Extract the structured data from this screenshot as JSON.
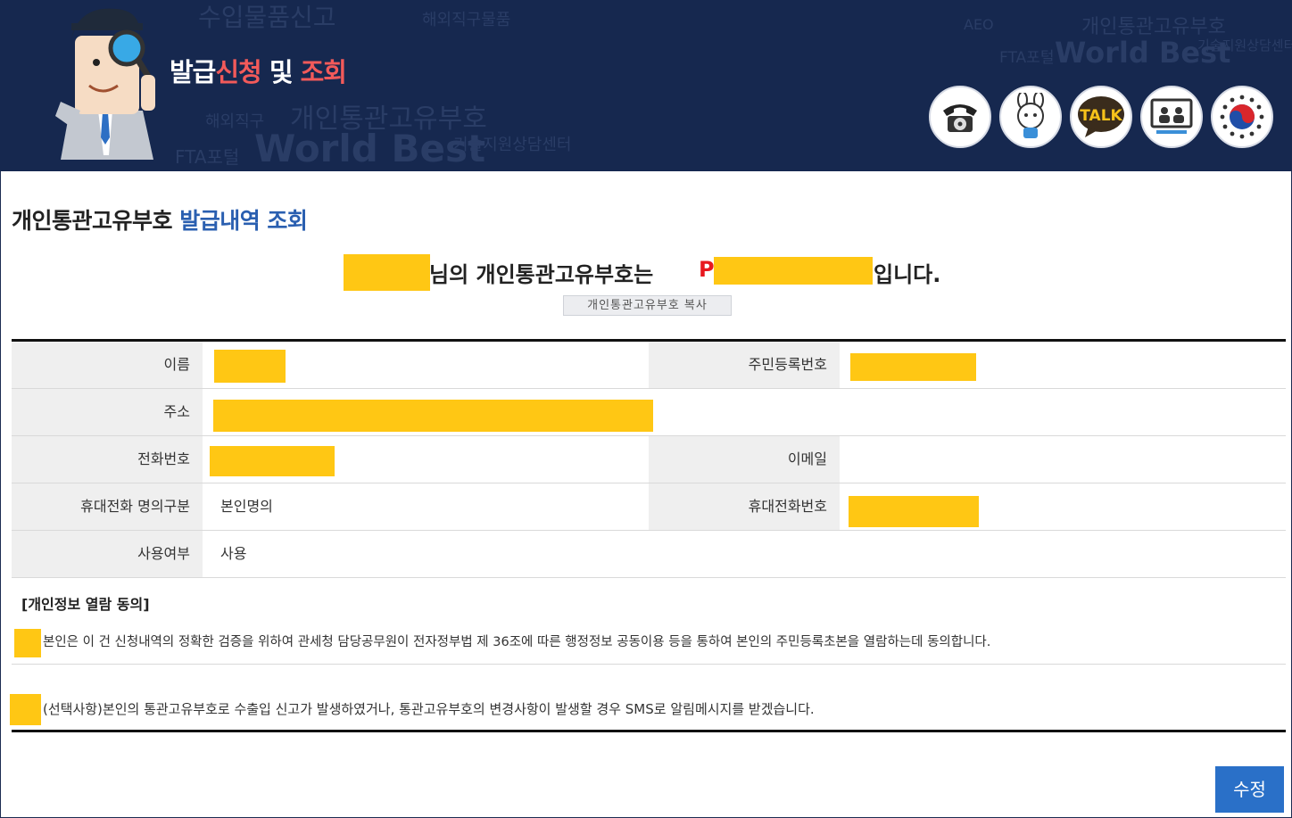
{
  "banner": {
    "title_part1": "발급",
    "title_part2": "신청",
    "title_part3": " 및 ",
    "title_part4": "조회",
    "bg_words": [
      "수입물품신고",
      "해외직구물품",
      "개인통관고유부호",
      "World Best",
      "기술지원상담센터",
      "FTA포털",
      "AEO",
      "해외직구",
      "개인통관고유부호",
      "World Best",
      "기술지원상담센터",
      "FTA포털"
    ],
    "icons": [
      "phone-icon",
      "mascot-icon",
      "talk-icon",
      "video-consult-icon",
      "government-emblem-icon"
    ],
    "talk_label": "TALK"
  },
  "page": {
    "title_black": "개인통관고유부호 ",
    "title_blue": "발급내역 조회",
    "sentence_mid": "님의 개인통관고유부호는",
    "code_prefix": "P",
    "sentence_end": "입니다.",
    "copy_button": "개인통관고유부호 복사"
  },
  "table": {
    "name_label": "이름",
    "rrn_label": "주민등록번호",
    "address_label": "주소",
    "phone_label": "전화번호",
    "email_label": "이메일",
    "email_value": "",
    "mobile_type_label": "휴대전화 명의구분",
    "mobile_type_value": "본인명의",
    "mobile_label": "휴대전화번호",
    "use_label": "사용여부",
    "use_value": "사용"
  },
  "consent": {
    "title": "[개인정보 열람 동의]",
    "text1": "본인은 이 건 신청내역의 정확한 검증을 위하여 관세청 담당공무원이 전자정부법 제 36조에 따른 행정정보 공동이용 등을 통하여 본인의 주민등록초본을 열람하는데 동의합니다.",
    "text2": "(선택사항)본인의 통관고유부호로 수출입 신고가 발생하였거나, 통관고유부호의 변경사항이 발생할 경우 SMS로 알림메시지를 받겠습니다."
  },
  "actions": {
    "edit_button": "수정"
  },
  "colors": {
    "banner_bg": "#16284f",
    "accent_red": "#f25a5a",
    "title_blue": "#2a5fb0",
    "redaction": "#ffc714",
    "button_blue": "#2a70c8"
  }
}
